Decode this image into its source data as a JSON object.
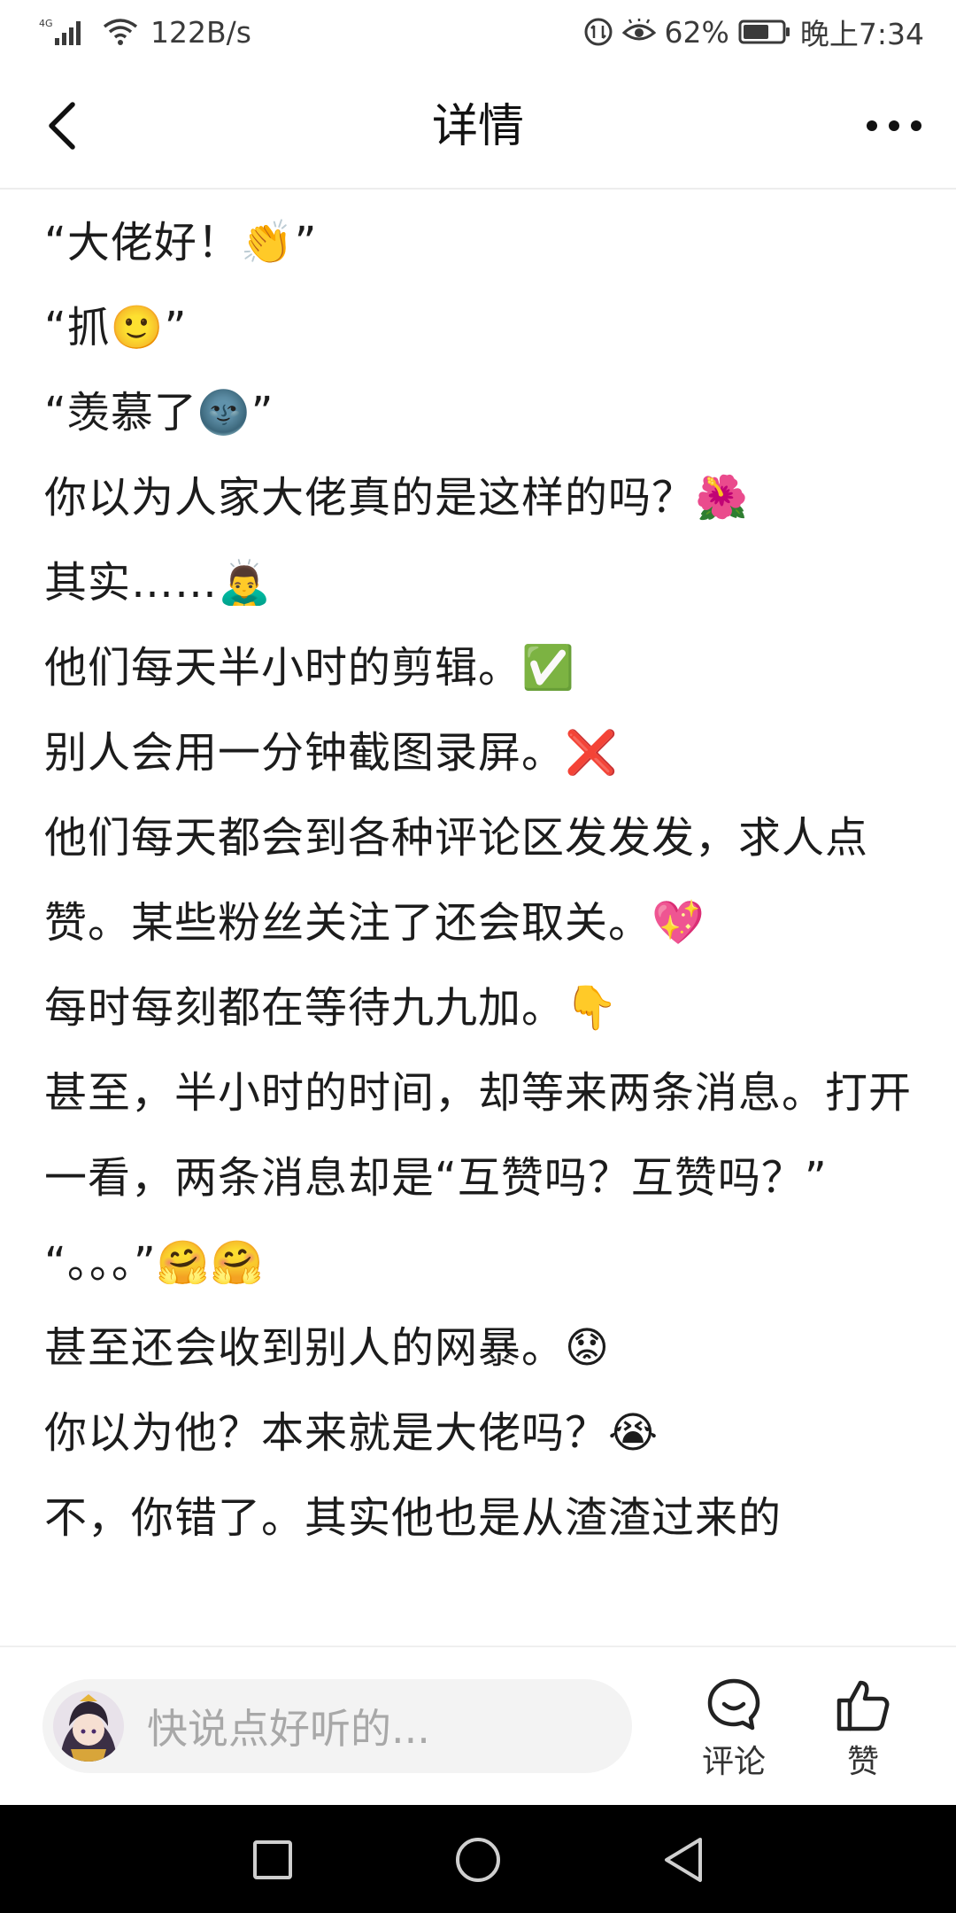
{
  "status_bar": {
    "network": "4G",
    "speed": "122B/s",
    "battery_percent": "62%",
    "time": "晚上7:34"
  },
  "header": {
    "title": "详情"
  },
  "content": {
    "paragraphs": [
      "“大佬好！👏”",
      "“抓🙂”",
      "“羡慕了🌚”",
      "你以为人家大佬真的是这样的吗？🌺",
      "其实……🙇‍♂️",
      "他们每天半小时的剪辑。✅",
      "别人会用一分钟截图录屏。❌",
      "他们每天都会到各种评论区发发发，求人点赞。某些粉丝关注了还会取关。💖",
      "每时每刻都在等待九九加。👇",
      "甚至，半小时的时间，却等来两条消息。打开一看，两条消息却是“互赞吗？互赞吗？” “。。。”🤗🤗",
      "甚至还会收到别人的网暴。😟",
      "你以为他？本来就是大佬吗？😭",
      "不，你错了。其实他也是从渣渣过来的"
    ]
  },
  "comment_bar": {
    "placeholder": "快说点好听的...",
    "comment_label": "评论",
    "like_label": "赞"
  },
  "colors": {
    "text": "#1c1c1c",
    "placeholder": "#a8a8a8",
    "input_bg": "#f3f3f3",
    "nav_bg": "#000000"
  }
}
